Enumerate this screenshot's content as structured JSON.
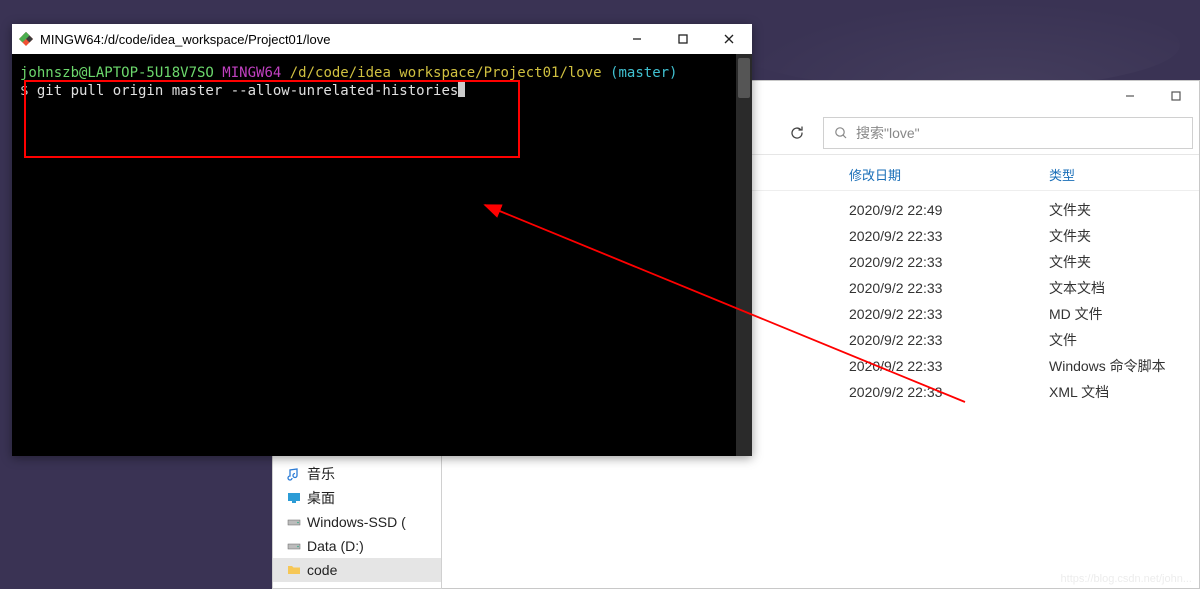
{
  "terminal": {
    "title": "MINGW64:/d/code/idea_workspace/Project01/love",
    "prompt": {
      "user": "johnszb@LAPTOP-5U18V7SO",
      "host": " MINGW64 ",
      "path": "/d/code/idea_workspace/Project01/love",
      "branch": "(master)"
    },
    "dollar": "$ ",
    "command": "git pull origin master --allow-unrelated-histories"
  },
  "explorer": {
    "search_placeholder": "搜索\"love\"",
    "columns": {
      "date": "修改日期",
      "type": "类型"
    },
    "rows": [
      {
        "date": "2020/9/2 22:49",
        "type": "文件夹"
      },
      {
        "date": "2020/9/2 22:33",
        "type": "文件夹"
      },
      {
        "date": "2020/9/2 22:33",
        "type": "文件夹"
      },
      {
        "date": "2020/9/2 22:33",
        "type": "文本文档"
      },
      {
        "date": "2020/9/2 22:33",
        "type": "MD 文件"
      },
      {
        "date": "2020/9/2 22:33",
        "type": "文件"
      },
      {
        "date": "2020/9/2 22:33",
        "type": "Windows 命令脚本"
      },
      {
        "date": "2020/9/2 22:33",
        "type": "XML 文档"
      }
    ]
  },
  "sidebar": {
    "items": [
      {
        "label": "音乐",
        "icon": "music"
      },
      {
        "label": "桌面",
        "icon": "desktop"
      },
      {
        "label": "Windows-SSD (",
        "icon": "drive"
      },
      {
        "label": "Data (D:)",
        "icon": "drive"
      },
      {
        "label": "code",
        "icon": "folder",
        "selected": true
      }
    ]
  },
  "watermark": "https://blog.csdn.net/john..."
}
